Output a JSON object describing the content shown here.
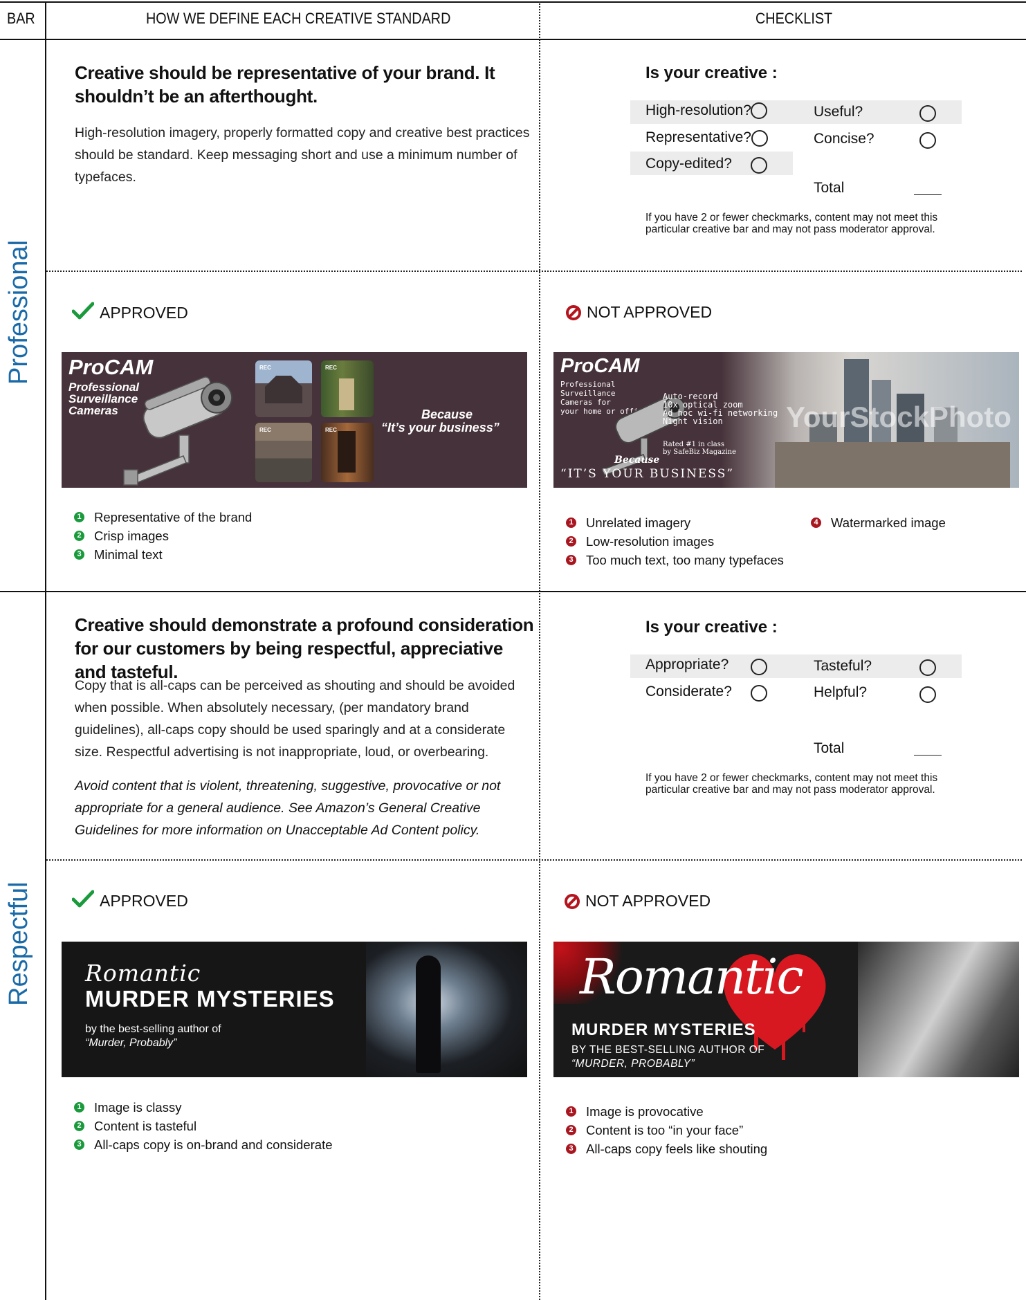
{
  "header": {
    "bar": "BAR",
    "define": "HOW WE DEFINE EACH CREATIVE STANDARD",
    "checklist": "CHECKLIST"
  },
  "colors": {
    "label_blue": "#1a6aa8",
    "approved_green": "#1a9a3c",
    "not_approved_red": "#a81620",
    "banner_plum": "#46323a"
  },
  "professional": {
    "bar_label": "Professional",
    "headline": "Creative should be representative of your brand. It shouldn’t be an afterthought.",
    "body": "High-resolution imagery, properly formatted copy and creative best practices should be standard. Keep messaging short and use a minimum number of typefaces.",
    "checklist": {
      "title": "Is your creative :",
      "items": [
        "High-resolution?",
        "Useful?",
        "Representative?",
        "Concise?",
        "Copy-edited?"
      ],
      "total": "Total",
      "note": "If you have 2 or fewer checkmarks, content may not meet this particular creative bar and may not pass moderator approval."
    },
    "approved": {
      "label": "APPROVED",
      "banner": {
        "brand": "ProCAM",
        "sub": [
          "Professional",
          "Surveillance",
          "Cameras"
        ],
        "tag1": "Because",
        "tag2": "“It’s your business”",
        "rec": "REC"
      },
      "bullets": [
        "Representative of the brand",
        "Crisp images",
        "Minimal text"
      ]
    },
    "not_approved": {
      "label": "NOT APPROVED",
      "banner": {
        "brand": "ProCAM",
        "sub": [
          "Professional",
          "Surveillance",
          "Cameras for",
          "your home or office"
        ],
        "features": [
          "Auto-record",
          "10x optical zoom",
          "Ad hoc wi-fi networking",
          "Night vision"
        ],
        "rated": [
          "Rated #1 in class",
          "by SafeBiz Magazine"
        ],
        "because": "Because",
        "tagline": "“IT’S YOUR BUSINESS”",
        "watermark": "YourStockPhoto"
      },
      "bullets": [
        "Unrelated imagery",
        "Low-resolution images",
        "Too much text, too many typefaces",
        "Watermarked image"
      ]
    }
  },
  "respectful": {
    "bar_label": "Respectful",
    "headline": "Creative should demonstrate a profound consideration for our customers by being respectful, appreciative and tasteful.",
    "body": "Copy that is all-caps can be perceived as shouting and should be avoided when possible. When absolutely necessary, (per mandatory brand guidelines), all-caps copy should be used sparingly and at a considerate size. Respectful advertising is not inappropriate, loud, or overbearing.",
    "italic": "Avoid content that is violent, threatening, suggestive, provocative or not appropriate for a general audience. See Amazon’s General Creative Guidelines for more information on Unacceptable Ad Content policy.",
    "checklist": {
      "title": "Is your creative :",
      "items": [
        "Appropriate?",
        "Tasteful?",
        "Considerate?",
        "Helpful?"
      ],
      "total": "Total",
      "note": "If you have 2 or fewer checkmarks, content may not meet this particular creative bar and may not pass moderator approval."
    },
    "approved": {
      "label": "APPROVED",
      "banner": {
        "script": "Romantic",
        "title": "MURDER MYSTERIES",
        "line1": "by the best-selling author of",
        "line2": "“Murder, Probably”"
      },
      "bullets": [
        "Image is classy",
        "Content is tasteful",
        "All-caps copy is on-brand and considerate"
      ]
    },
    "not_approved": {
      "label": "NOT APPROVED",
      "banner": {
        "script": "Romantic",
        "title": "MURDER MYSTERIES",
        "line1": "BY THE BEST-SELLING AUTHOR OF",
        "line2": "“MURDER, PROBABLY”"
      },
      "bullets": [
        "Image is provocative",
        "Content is too “in your face”",
        "All-caps copy feels like shouting"
      ]
    }
  }
}
